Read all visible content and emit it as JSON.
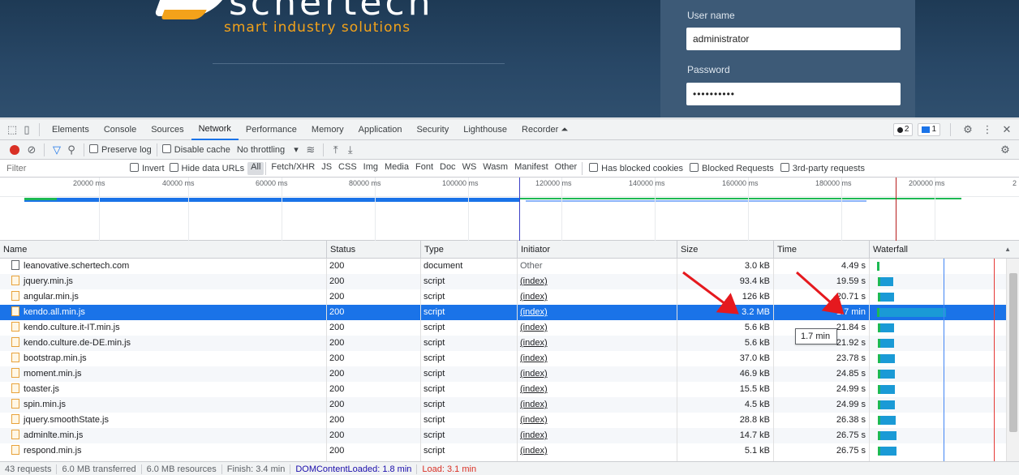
{
  "web_page": {
    "brand_word": "schertech",
    "brand_tagline": "smart industry solutions",
    "login": {
      "username_label": "User name",
      "username_value": "administrator",
      "password_label": "Password",
      "password_value": "••••••••••"
    }
  },
  "devtools": {
    "tabs": [
      "Elements",
      "Console",
      "Sources",
      "Network",
      "Performance",
      "Memory",
      "Application",
      "Security",
      "Lighthouse",
      "Recorder ⏶"
    ],
    "active_tab": "Network",
    "issues_count": "2",
    "messages_count": "1",
    "toolbar": {
      "preserve_log": "Preserve log",
      "disable_cache": "Disable cache",
      "throttling": "No throttling"
    },
    "filter": {
      "placeholder": "Filter",
      "invert": "Invert",
      "hide_data_urls": "Hide data URLs",
      "types": [
        "All",
        "Fetch/XHR",
        "JS",
        "CSS",
        "Img",
        "Media",
        "Font",
        "Doc",
        "WS",
        "Wasm",
        "Manifest",
        "Other"
      ],
      "active_type": "All",
      "blocked_cookies": "Has blocked cookies",
      "blocked_requests": "Blocked Requests",
      "third_party": "3rd-party requests"
    },
    "overview_ticks": [
      "20000 ms",
      "40000 ms",
      "60000 ms",
      "80000 ms",
      "100000 ms",
      "120000 ms",
      "140000 ms",
      "160000 ms",
      "180000 ms",
      "200000 ms",
      "2"
    ],
    "columns": [
      "Name",
      "Status",
      "Type",
      "Initiator",
      "Size",
      "Time",
      "Waterfall"
    ],
    "rows": [
      {
        "name": "leanovative.schertech.com",
        "status": "200",
        "type": "document",
        "initiator": "Other",
        "size": "3.0 kB",
        "time": "4.49 s",
        "kind": "doc"
      },
      {
        "name": "jquery.min.js",
        "status": "200",
        "type": "script",
        "initiator": "(index)",
        "size": "93.4 kB",
        "time": "19.59 s",
        "kind": "js"
      },
      {
        "name": "angular.min.js",
        "status": "200",
        "type": "script",
        "initiator": "(index)",
        "size": "126 kB",
        "time": "20.71 s",
        "kind": "js"
      },
      {
        "name": "kendo.all.min.js",
        "status": "200",
        "type": "script",
        "initiator": "(index)",
        "size": "3.2 MB",
        "time": "1.7 min",
        "kind": "js"
      },
      {
        "name": "kendo.culture.it-IT.min.js",
        "status": "200",
        "type": "script",
        "initiator": "(index)",
        "size": "5.6 kB",
        "time": "21.84 s",
        "kind": "js"
      },
      {
        "name": "kendo.culture.de-DE.min.js",
        "status": "200",
        "type": "script",
        "initiator": "(index)",
        "size": "5.6 kB",
        "time": "21.92 s",
        "kind": "js"
      },
      {
        "name": "bootstrap.min.js",
        "status": "200",
        "type": "script",
        "initiator": "(index)",
        "size": "37.0 kB",
        "time": "23.78 s",
        "kind": "js"
      },
      {
        "name": "moment.min.js",
        "status": "200",
        "type": "script",
        "initiator": "(index)",
        "size": "46.9 kB",
        "time": "24.85 s",
        "kind": "js"
      },
      {
        "name": "toaster.js",
        "status": "200",
        "type": "script",
        "initiator": "(index)",
        "size": "15.5 kB",
        "time": "24.99 s",
        "kind": "js"
      },
      {
        "name": "spin.min.js",
        "status": "200",
        "type": "script",
        "initiator": "(index)",
        "size": "4.5 kB",
        "time": "24.99 s",
        "kind": "js"
      },
      {
        "name": "jquery.smoothState.js",
        "status": "200",
        "type": "script",
        "initiator": "(index)",
        "size": "28.8 kB",
        "time": "26.38 s",
        "kind": "js"
      },
      {
        "name": "adminlte.min.js",
        "status": "200",
        "type": "script",
        "initiator": "(index)",
        "size": "14.7 kB",
        "time": "26.75 s",
        "kind": "js"
      },
      {
        "name": "respond.min.js",
        "status": "200",
        "type": "script",
        "initiator": "(index)",
        "size": "5.1 kB",
        "time": "26.75 s",
        "kind": "js"
      }
    ],
    "selected_row": 3,
    "tooltip": "1.7 min",
    "status_bar": {
      "requests": "43 requests",
      "transferred": "6.0 MB transferred",
      "resources": "6.0 MB resources",
      "finish": "Finish: 3.4 min",
      "dom_loaded": "DOMContentLoaded: 1.8 min",
      "load": "Load: 3.1 min"
    },
    "colors": {
      "accent": "#1a73e8",
      "arrow": "#e5191e",
      "waterfall_wait": "#1db954",
      "waterfall_receive": "#1a9ad6"
    }
  }
}
